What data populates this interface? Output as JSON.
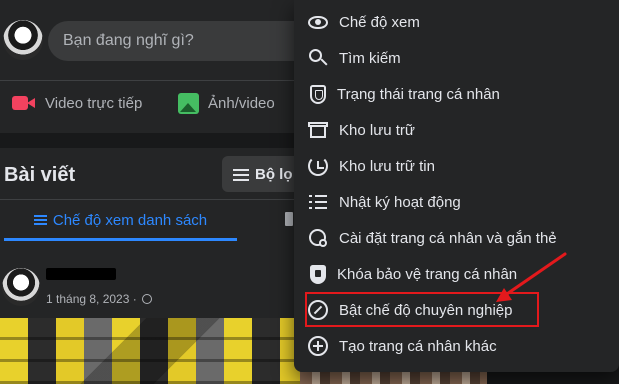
{
  "composer": {
    "placeholder": "Bạn đang nghĩ gì?",
    "live_label": "Video trực tiếp",
    "photo_label": "Ảnh/video"
  },
  "posts": {
    "title": "Bài viết",
    "filter_label": "Bộ lọ",
    "list_view_tab": "Chế độ xem danh sách"
  },
  "post": {
    "date": "1 tháng 8, 2023 ·"
  },
  "menu": {
    "items": [
      {
        "label": "Chế độ xem",
        "icon": "eye-icon"
      },
      {
        "label": "Tìm kiếm",
        "icon": "search-icon"
      },
      {
        "label": "Trạng thái trang cá nhân",
        "icon": "shield-icon"
      },
      {
        "label": "Kho lưu trữ",
        "icon": "archive-icon"
      },
      {
        "label": "Kho lưu trữ tin",
        "icon": "history-clock-icon"
      },
      {
        "label": "Nhật ký hoạt động",
        "icon": "list-icon"
      },
      {
        "label": "Cài đặt trang cá nhân và gắn thẻ",
        "icon": "user-settings-icon"
      },
      {
        "label": "Khóa bảo vệ trang cá nhân",
        "icon": "lock-shield-icon"
      },
      {
        "label": "Bật chế độ chuyên nghiệp",
        "icon": "professional-mode-icon"
      },
      {
        "label": "Tạo trang cá nhân khác",
        "icon": "plus-circle-icon"
      }
    ]
  },
  "colors": {
    "background": "#18191a",
    "card": "#242526",
    "accent": "#2d88ff",
    "annotation": "#e3191c"
  }
}
